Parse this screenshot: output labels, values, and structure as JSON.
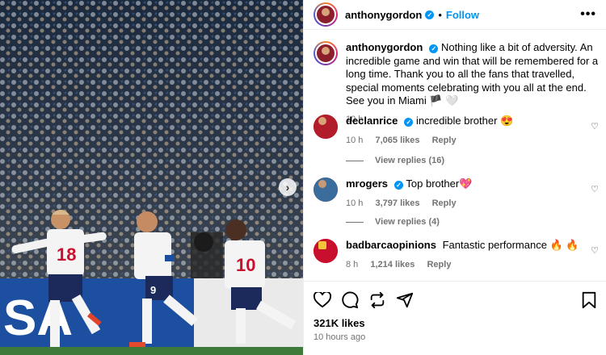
{
  "post": {
    "author": "anthonygordon",
    "follow_label": "Follow",
    "separator": "•",
    "more_label": "•••",
    "caption": "Nothing like a bit of adversity. An incredible game and win that will be remembered for a long time. Thank you to all the fans that travelled, special moments celebrating with you all at the end. See you in Miami 🏴 🤍",
    "caption_time": "10 h",
    "likes": "321K likes",
    "posted_ago": "10 hours ago"
  },
  "comments": [
    {
      "user": "declanrice",
      "text": "incredible brother 😍",
      "time": "10 h",
      "likes": "7,065 likes",
      "reply": "Reply",
      "view_replies": "View replies (16)"
    },
    {
      "user": "mrogers",
      "text": "Top brother💖",
      "time": "10 h",
      "likes": "3,797 likes",
      "reply": "Reply",
      "view_replies": "View replies (4)"
    },
    {
      "user": "badbarcaopinions",
      "text": "Fantastic performance 🔥 🔥",
      "time": "8 h",
      "likes": "1,214 likes",
      "reply": "Reply"
    }
  ],
  "photo": {
    "ad_text": "SA",
    "player_left_number": "18",
    "player_mid_number": "9",
    "player_right_number": "10",
    "next_arrow": "›"
  },
  "icons": {
    "verified": "✓",
    "heart": "♡"
  },
  "colors": {
    "accent": "#0095f6",
    "muted": "#737373",
    "ad_board": "#1d4fa0"
  }
}
